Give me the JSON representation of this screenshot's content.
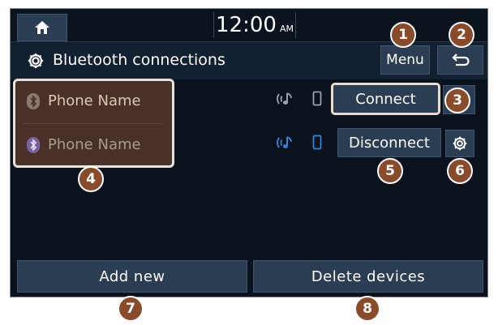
{
  "topbar": {
    "home_icon": "home-icon",
    "time": "12:00",
    "ampm": "AM"
  },
  "header": {
    "title": "Bluetooth connections",
    "menu_label": "Menu",
    "back_icon": "back-arrow-icon"
  },
  "devices": [
    {
      "name": "Phone Name",
      "icon": "bluetooth-icon"
    },
    {
      "name": "Phone Name",
      "icon": "bluetooth-icon"
    }
  ],
  "actions": {
    "connect_label": "Connect",
    "disconnect_label": "Disconnect"
  },
  "bottom": {
    "add_label": "Add new",
    "delete_label": "Delete devices"
  },
  "callouts": [
    "1",
    "2",
    "3",
    "4",
    "5",
    "6",
    "7",
    "8"
  ],
  "colors": {
    "screen_bg": "#0a121d",
    "button_bg": "#2b3d52",
    "highlight_bg": "#4a3128",
    "callout_bg": "#8a4b2a",
    "active_indicator": "#2f86d6",
    "inactive_indicator": "#9aa3ad"
  }
}
